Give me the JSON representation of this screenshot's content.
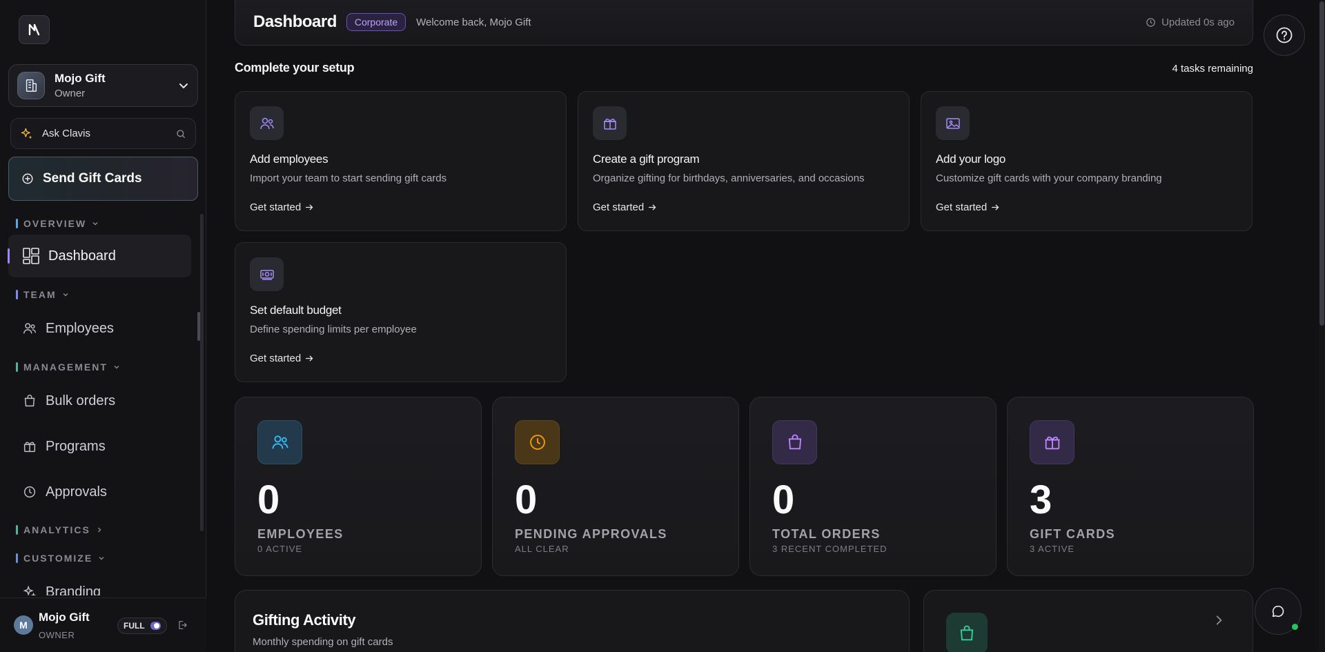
{
  "sidebar": {
    "org": {
      "name": "Mojo Gift",
      "role": "Owner"
    },
    "ask_label": "Ask Clavis",
    "send_button": "Send Gift Cards",
    "sections": {
      "overview": "OVERVIEW",
      "team": "TEAM",
      "management": "MANAGEMENT",
      "analytics": "ANALYTICS",
      "customize": "CUSTOMIZE"
    },
    "items": {
      "dashboard": "Dashboard",
      "employees": "Employees",
      "bulk_orders": "Bulk orders",
      "programs": "Programs",
      "approvals": "Approvals",
      "branding": "Branding"
    },
    "user": {
      "initial": "M",
      "name": "Mojo Gift",
      "role": "OWNER",
      "mode_label": "FULL"
    }
  },
  "header": {
    "title": "Dashboard",
    "badge": "Corporate",
    "welcome": "Welcome back, Mojo Gift",
    "updated": "Updated 0s ago"
  },
  "setup": {
    "title": "Complete your setup",
    "remaining": "4 tasks remaining",
    "tasks": [
      {
        "title": "Add employees",
        "desc": "Import your team to start sending gift cards",
        "link": "Get started",
        "icon": "users-icon"
      },
      {
        "title": "Create a gift program",
        "desc": "Organize gifting for birthdays, anniversaries, and occasions",
        "link": "Get started",
        "icon": "gift-icon"
      },
      {
        "title": "Add your logo",
        "desc": "Customize gift cards with your company branding",
        "link": "Get started",
        "icon": "image-icon"
      },
      {
        "title": "Set default budget",
        "desc": "Define spending limits per employee",
        "link": "Get started",
        "icon": "banknote-icon"
      }
    ]
  },
  "stats": [
    {
      "value": "0",
      "label": "EMPLOYEES",
      "sub": "0 ACTIVE",
      "icon": "users-icon",
      "color": "#38bdf8"
    },
    {
      "value": "0",
      "label": "PENDING APPROVALS",
      "sub": "ALL CLEAR",
      "icon": "clock-icon",
      "color": "#f59e0b"
    },
    {
      "value": "0",
      "label": "TOTAL ORDERS",
      "sub": "3 RECENT COMPLETED",
      "icon": "shopping-bag-icon",
      "color": "#c084fc"
    },
    {
      "value": "3",
      "label": "GIFT CARDS",
      "sub": "3 ACTIVE",
      "icon": "gift-icon",
      "color": "#c084fc"
    }
  ],
  "activity": {
    "title": "Gifting Activity",
    "subtitle": "Monthly spending on gift cards"
  },
  "colors": {
    "accent": "#9f86ff",
    "badge_text": "#b9a2ff",
    "success": "#22c55e"
  }
}
